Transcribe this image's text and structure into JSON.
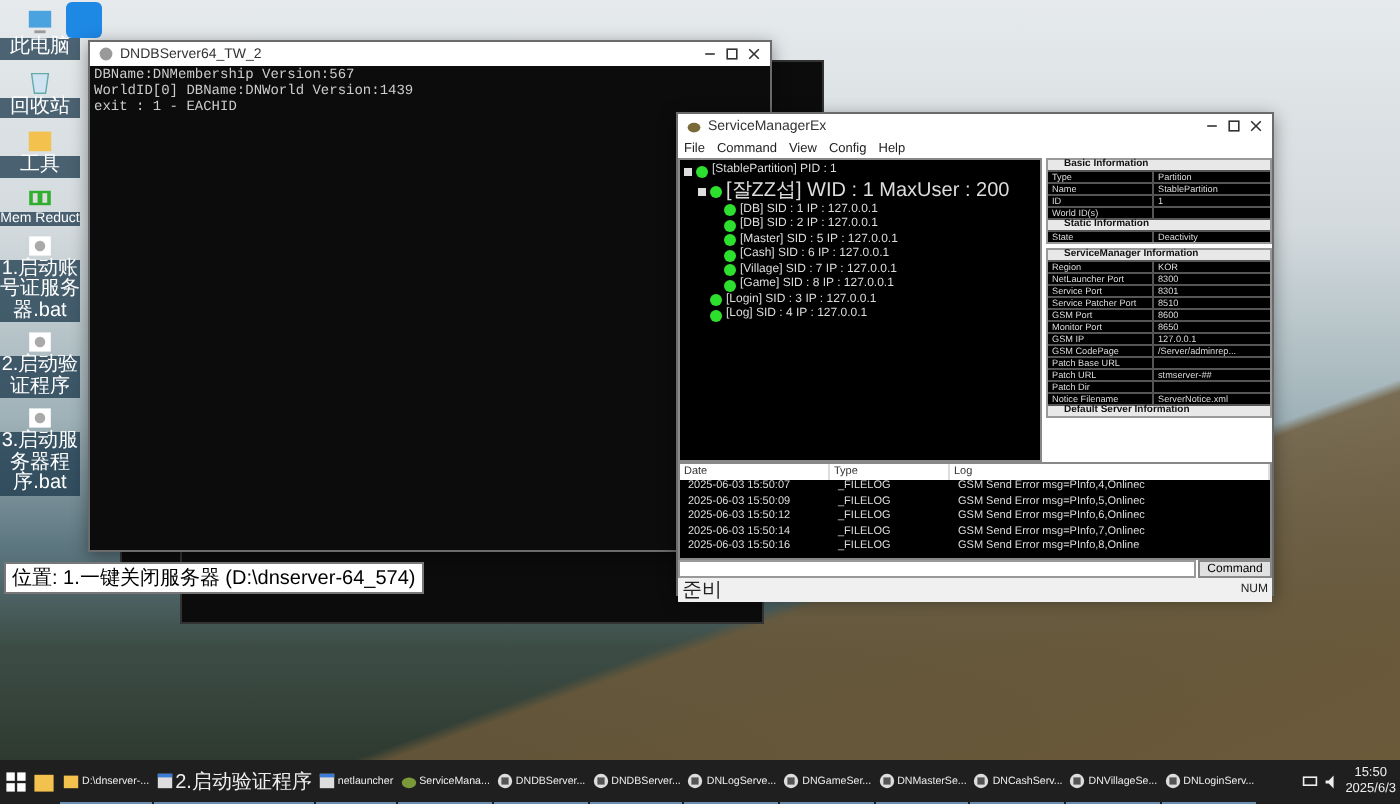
{
  "desktop": {
    "icons": [
      {
        "kind": "pc",
        "label": "此电脑"
      },
      {
        "kind": "recycle",
        "label": "回收站"
      },
      {
        "kind": "folder",
        "label": "工具"
      },
      {
        "kind": "mem",
        "label": "Mem Reduct"
      },
      {
        "kind": "bat",
        "label": "1.启动账号证服务器.bat"
      },
      {
        "kind": "bat",
        "label": "2.启动验证程序"
      },
      {
        "kind": "bat",
        "label": "3.启动服务器程序.bat"
      }
    ],
    "tooltip": "位置: 1.一键关闭服务器 (D:\\dnserver-64_574)"
  },
  "console": {
    "title": "DNDBServer64_TW_2",
    "lines": [
      "DBName:DNMembership Version:567",
      "WorldID[0] DBName:DNWorld Version:1439",
      "exit : 1 - EACHID"
    ]
  },
  "service_manager": {
    "title": "ServiceManagerEx",
    "menu": [
      "File",
      "Command",
      "View",
      "Config",
      "Help"
    ],
    "tree": [
      {
        "label": "[StablePartition] PID : 1",
        "expanded": true,
        "children": [
          {
            "label": "[잘ZZ섭] WID : 1 MaxUser : 200",
            "expanded": true,
            "children": [
              {
                "label": "[DB] SID : 1 IP : 127.0.0.1"
              },
              {
                "label": "[DB] SID : 2 IP : 127.0.0.1"
              },
              {
                "label": "[Master] SID : 5 IP : 127.0.0.1"
              },
              {
                "label": "[Cash] SID : 6 IP : 127.0.0.1"
              },
              {
                "label": "[Village] SID : 7 IP : 127.0.0.1"
              },
              {
                "label": "[Game] SID : 8 IP : 127.0.0.1"
              }
            ]
          },
          {
            "label": "[Login] SID : 3 IP : 127.0.0.1"
          },
          {
            "label": "[Log] SID : 4 IP : 127.0.0.1"
          }
        ]
      }
    ],
    "grids": [
      {
        "sections": [
          {
            "title": "Basic Information",
            "rows": [
              {
                "key": "Type",
                "value": "Partition"
              },
              {
                "key": "Name",
                "value": "StablePartition"
              },
              {
                "key": "ID",
                "value": "1"
              },
              {
                "key": "World ID(s)"
              }
            ]
          },
          {
            "title": "Static Information",
            "rows": [
              {
                "key": "State",
                "value": "Deactivity"
              }
            ]
          }
        ]
      },
      {
        "sections": [
          {
            "title": "ServiceManager Information",
            "rows": [
              {
                "key": "Region",
                "value": "KOR"
              },
              {
                "key": "NetLauncher Port",
                "value": "8300"
              },
              {
                "key": "Service Port",
                "value": "8301"
              },
              {
                "key": "Service Patcher Port",
                "value": "8510"
              },
              {
                "key": "GSM Port",
                "value": "8600"
              },
              {
                "key": "Monitor Port",
                "value": "8650"
              },
              {
                "key": "GSM IP",
                "value": "127.0.0.1"
              },
              {
                "key": "GSM CodePage",
                "value": "/Server/adminrep..."
              },
              {
                "key": "Patch Base URL"
              },
              {
                "key": "Patch URL",
                "value": "stmserver-##"
              },
              {
                "key": "Patch Dir"
              },
              {
                "key": "Notice Filename",
                "value": "ServerNotice.xml"
              }
            ]
          },
          {
            "title": "Default Server Information"
          }
        ]
      }
    ],
    "log": {
      "columns": [
        "Date",
        "Type",
        "Log"
      ],
      "rows": [
        [
          "2025-06-03 15:50:07",
          "_FILELOG",
          "GSM Send Error msg=PInfo,4,Onlinec"
        ],
        [
          "2025-06-03 15:50:09",
          "_FILELOG",
          "GSM Send Error msg=PInfo,5,Onlinec"
        ],
        [
          "2025-06-03 15:50:12",
          "_FILELOG",
          "GSM Send Error msg=PInfo,6,Onlinec"
        ],
        [
          "2025-06-03 15:50:14",
          "_FILELOG",
          "GSM Send Error msg=PInfo,7,Onlinec"
        ],
        [
          "2025-06-03 15:50:16",
          "_FILELOG",
          "GSM Send Error msg=PInfo,8,Online"
        ]
      ]
    },
    "command_button": "Command",
    "status": "준비",
    "status_indicator": "NUM"
  },
  "taskbar": {
    "items": [
      {
        "kind": "folder",
        "label": "D:\\dnserver-..."
      },
      {
        "kind": "window",
        "label": "2.启动验证程序"
      },
      {
        "kind": "window",
        "label": "netlauncher"
      },
      {
        "kind": "app",
        "label": "ServiceMana..."
      },
      {
        "kind": "console",
        "label": "DNDBServer..."
      },
      {
        "kind": "console",
        "label": "DNDBServer..."
      },
      {
        "kind": "console",
        "label": "DNLogServe..."
      },
      {
        "kind": "console",
        "label": "DNGameSer..."
      },
      {
        "kind": "console",
        "label": "DNMasterSe..."
      },
      {
        "kind": "console",
        "label": "DNCashServ..."
      },
      {
        "kind": "console",
        "label": "DNVillageSe..."
      },
      {
        "kind": "console",
        "label": "DNLoginServ..."
      }
    ],
    "time": "15:50",
    "date": "2025/6/3"
  }
}
